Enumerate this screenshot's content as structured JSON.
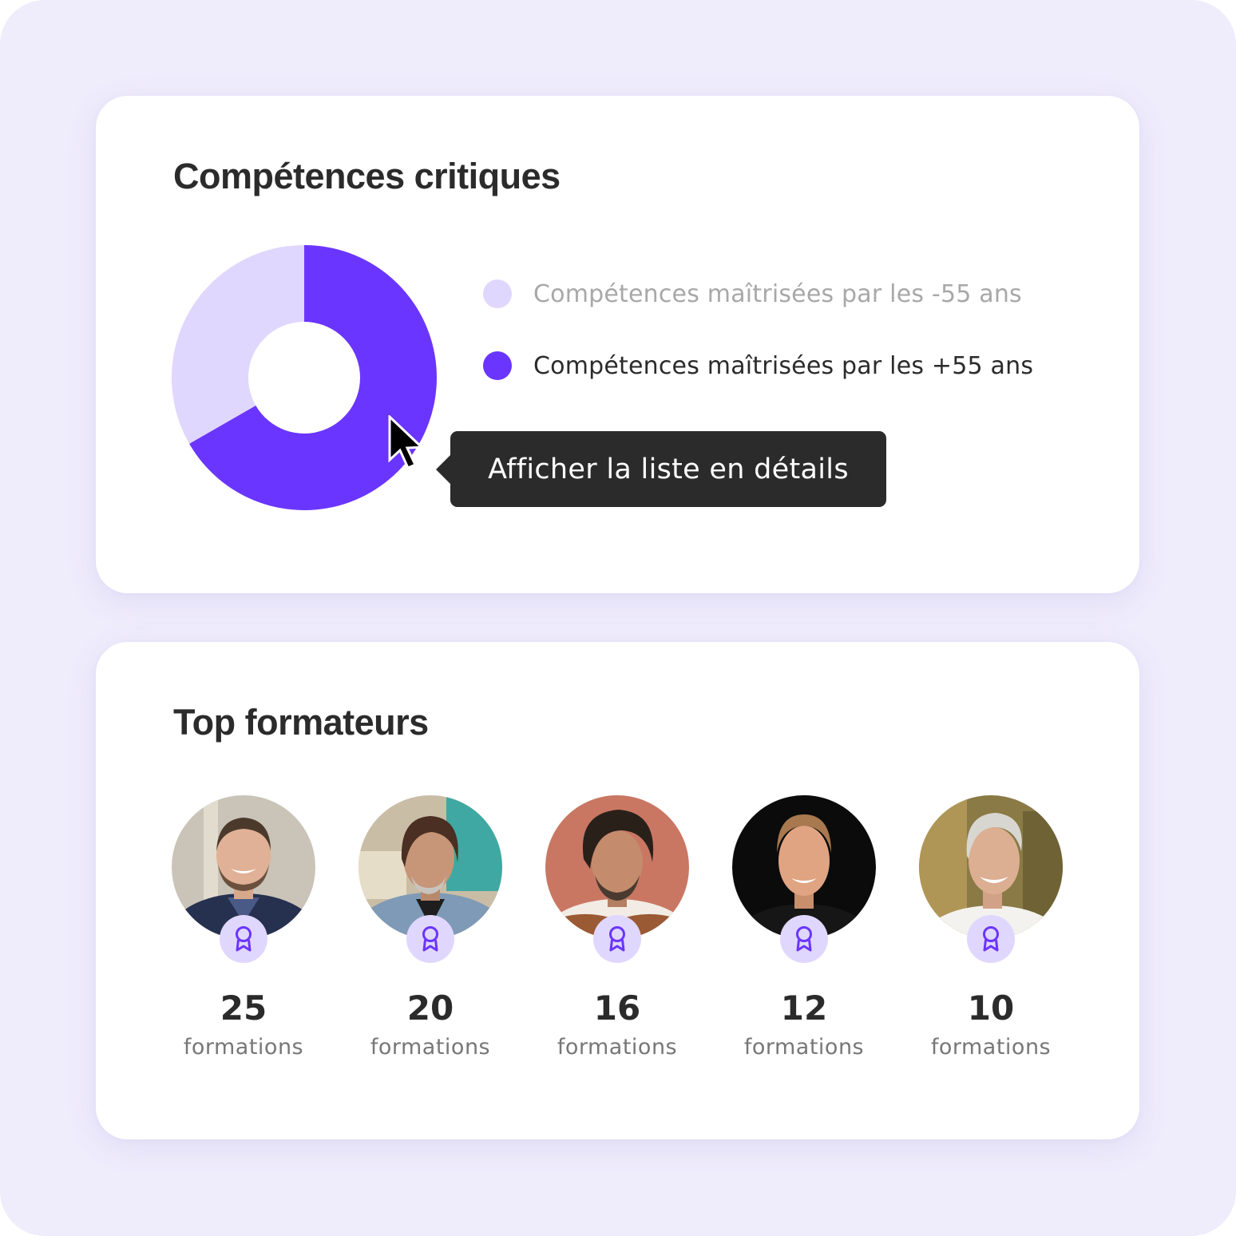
{
  "skills_card": {
    "title": "Compétences critiques",
    "tooltip": "Afficher la liste en détails",
    "legend": [
      {
        "label": "Compétences maîtrisées par les -55 ans",
        "color": "#e0d7fe",
        "state": "muted"
      },
      {
        "label": "Compétences maîtrisées par les +55 ans",
        "color": "#6a35ff",
        "state": "active"
      }
    ]
  },
  "chart_data": {
    "type": "pie",
    "variant": "donut",
    "title": "Compétences critiques",
    "categories": [
      "Compétences maîtrisées par les +55 ans",
      "Compétences maîtrisées par les -55 ans"
    ],
    "values": [
      66.7,
      33.3
    ],
    "unit": "percent",
    "colors": [
      "#6a35ff",
      "#e0d7fe"
    ],
    "start_angle": "12 o'clock",
    "direction": "clockwise",
    "legend_position": "right",
    "hovered_segment": "Compétences maîtrisées par les +55 ans"
  },
  "trainers_card": {
    "title": "Top formateurs",
    "badge_icon": "award-ribbon-icon",
    "badge_color": "#6a35ff",
    "trainers": [
      {
        "count": "25",
        "label": "formations",
        "avatar_bg": "#c9c3b8"
      },
      {
        "count": "20",
        "label": "formations",
        "avatar_bg": "#b9c7b8"
      },
      {
        "count": "16",
        "label": "formations",
        "avatar_bg": "#c97763"
      },
      {
        "count": "12",
        "label": "formations",
        "avatar_bg": "#0b0b0b"
      },
      {
        "count": "10",
        "label": "formations",
        "avatar_bg": "#8a7a45"
      }
    ]
  }
}
